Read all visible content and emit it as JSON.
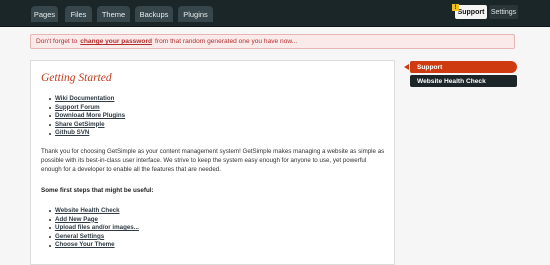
{
  "nav": {
    "tabs": [
      {
        "label": "Pages"
      },
      {
        "label": "Files"
      },
      {
        "label": "Theme"
      },
      {
        "label": "Backups"
      },
      {
        "label": "Plugins"
      }
    ],
    "alert_icon": "!",
    "support_label": "Support",
    "settings_label": "Settings"
  },
  "banner": {
    "text_before": "Don't forget to",
    "link": "change your password",
    "text_after": "from that random generated one you have now..."
  },
  "main": {
    "title": "Getting Started",
    "resources": [
      "Wiki Documentation",
      "Support Forum",
      "Download More Plugins",
      "Share GetSimple",
      "Github SVN"
    ],
    "intro": "Thank you for choosing GetSimple as your content management system! GetSimple makes managing a website as simple as possible with its best-in-class user interface. We strive to keep the system easy enough for anyone to use, yet powerful enough for a developer to enable all the features that are needed.",
    "steps_heading": "Some first steps that might be useful:",
    "first_steps": [
      "Website Health Check",
      "Add New Page",
      "Upload files and/or images...",
      "General Settings",
      "Choose Your Theme"
    ]
  },
  "sidebar": {
    "support": "Support",
    "health_check": "Website Health Check"
  },
  "colors": {
    "topbar": "#1b2629",
    "accent": "#cf3b10",
    "banner_bg": "#fbeaea",
    "banner_text": "#b23030"
  }
}
